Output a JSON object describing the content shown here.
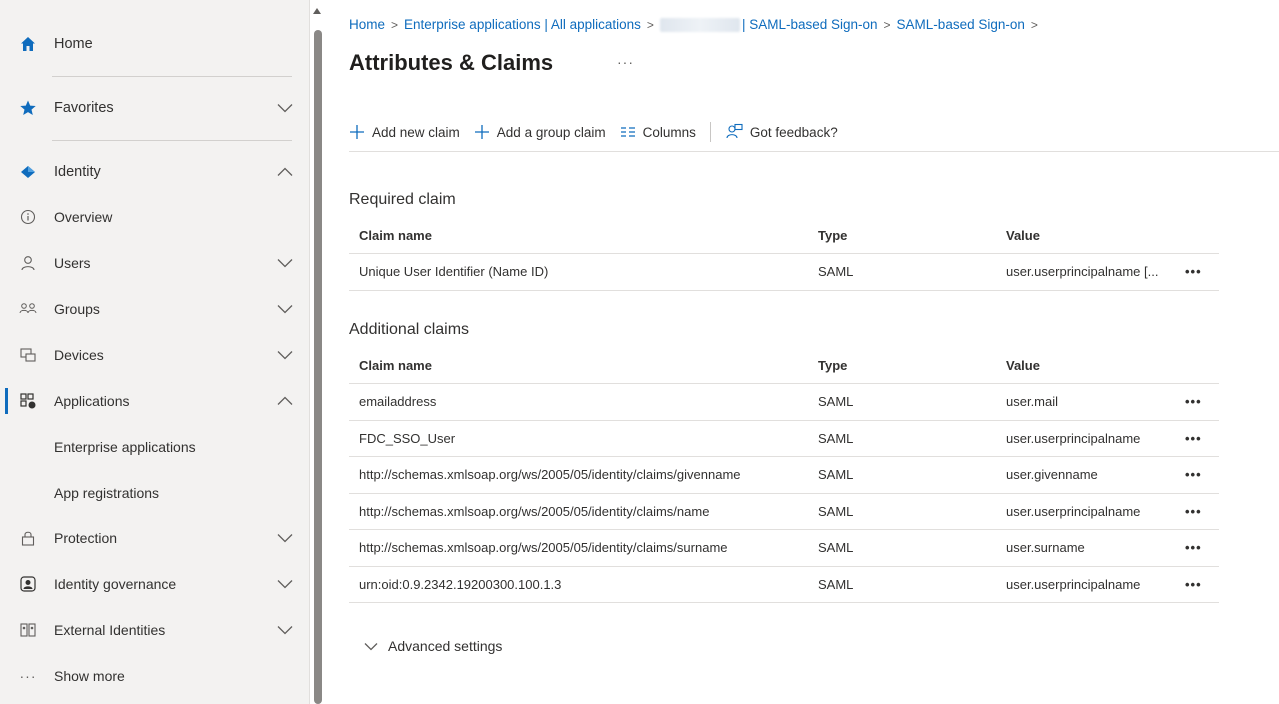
{
  "sidebar": {
    "items": [
      {
        "label": "Home",
        "icon": "home-icon"
      },
      {
        "label": "Favorites",
        "icon": "star-icon"
      },
      {
        "label": "Identity",
        "icon": "identity-icon"
      },
      {
        "label": "Overview",
        "icon": "info-icon"
      },
      {
        "label": "Users",
        "icon": "user-icon"
      },
      {
        "label": "Groups",
        "icon": "groups-icon"
      },
      {
        "label": "Devices",
        "icon": "devices-icon"
      },
      {
        "label": "Applications",
        "icon": "applications-icon"
      },
      {
        "label": "Enterprise applications"
      },
      {
        "label": "App registrations"
      },
      {
        "label": "Protection",
        "icon": "lock-icon"
      },
      {
        "label": "Identity governance",
        "icon": "governance-icon"
      },
      {
        "label": "External Identities",
        "icon": "external-identities-icon"
      },
      {
        "label": "Show more",
        "icon": "more-icon"
      }
    ]
  },
  "breadcrumb": {
    "home": "Home",
    "enterprise": "Enterprise applications | All applications",
    "saml1": "| SAML-based Sign-on",
    "saml2": "SAML-based Sign-on"
  },
  "page": {
    "title": "Attributes & Claims",
    "more": "···"
  },
  "toolbar": {
    "add_claim": "Add new claim",
    "add_group_claim": "Add a group claim",
    "columns": "Columns",
    "feedback": "Got feedback?"
  },
  "required": {
    "title": "Required claim",
    "headers": {
      "name": "Claim name",
      "type": "Type",
      "value": "Value"
    },
    "rows": [
      {
        "name": "Unique User Identifier (Name ID)",
        "type": "SAML",
        "value": "user.userprincipalname [...",
        "more": "•••"
      }
    ]
  },
  "additional": {
    "title": "Additional claims",
    "headers": {
      "name": "Claim name",
      "type": "Type",
      "value": "Value"
    },
    "rows": [
      {
        "name": "emailaddress",
        "type": "SAML",
        "value": "user.mail",
        "more": "•••"
      },
      {
        "name": "FDC_SSO_User",
        "type": "SAML",
        "value": "user.userprincipalname",
        "more": "•••"
      },
      {
        "name": "http://schemas.xmlsoap.org/ws/2005/05/identity/claims/givenname",
        "type": "SAML",
        "value": "user.givenname",
        "more": "•••"
      },
      {
        "name": "http://schemas.xmlsoap.org/ws/2005/05/identity/claims/name",
        "type": "SAML",
        "value": "user.userprincipalname",
        "more": "•••"
      },
      {
        "name": "http://schemas.xmlsoap.org/ws/2005/05/identity/claims/surname",
        "type": "SAML",
        "value": "user.surname",
        "more": "•••"
      },
      {
        "name": "urn:oid:0.9.2342.19200300.100.1.3",
        "type": "SAML",
        "value": "user.userprincipalname",
        "more": "•••"
      }
    ]
  },
  "advanced": {
    "label": "Advanced settings"
  },
  "colors": {
    "accent": "#0f6cbd",
    "sidebar_bg": "#f3f2f1",
    "text": "#323130"
  }
}
